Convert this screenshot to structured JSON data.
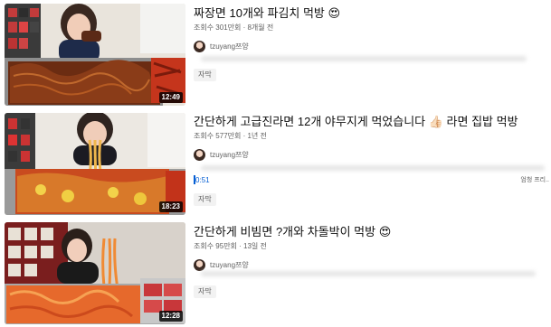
{
  "videos": [
    {
      "title": "짜장면 10개와 파김치 먹방 😍",
      "meta": "조회수 301만회 · 8개월 전",
      "channel": "tzuyang쯔양",
      "duration": "12:49",
      "chip": "자막",
      "food_color": "#7a3414"
    },
    {
      "title": "간단하게 고급진라면 12개 야무지게 먹었습니다 👍🏻 라면 집밥 먹방",
      "meta": "조회수 577만회 · 1년 전",
      "channel": "tzuyang쯔양",
      "duration": "18:23",
      "chip": "자막",
      "chapter_time": "0:51",
      "chapter_label": "엄청 프리..",
      "food_color": "#d9822b"
    },
    {
      "title": "간단하게 비빔면 ?개와 차돌박이 먹방 😍",
      "meta": "조회수 95만회 · 13일 전",
      "channel": "tzuyang쯔양",
      "duration": "12:28",
      "chip": "자막",
      "food_color": "#e0662b"
    }
  ]
}
